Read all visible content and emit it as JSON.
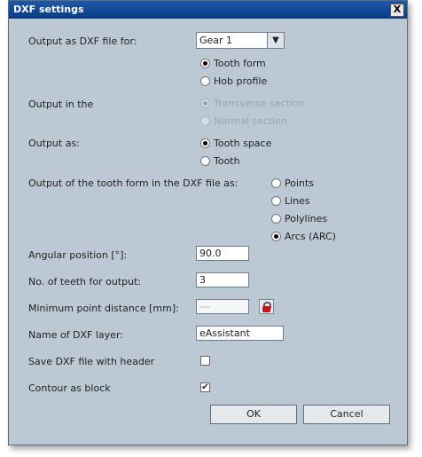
{
  "window": {
    "title": "DXF settings",
    "close_glyph": "X"
  },
  "output_for": {
    "label": "Output as DXF file for:",
    "selected": "Gear 1",
    "options": [
      {
        "label": "Tooth form",
        "checked": true
      },
      {
        "label": "Hob profile",
        "checked": false
      }
    ]
  },
  "output_in": {
    "label": "Output in the",
    "options": [
      {
        "label": "Transverse section",
        "checked": true,
        "disabled": true
      },
      {
        "label": "Normal section",
        "checked": false,
        "disabled": true
      }
    ]
  },
  "output_as": {
    "label": "Output as:",
    "options": [
      {
        "label": "Tooth space",
        "checked": true
      },
      {
        "label": "Tooth",
        "checked": false
      }
    ]
  },
  "tooth_form": {
    "label": "Output of the tooth form in the DXF file as:",
    "options": [
      {
        "label": "Points",
        "checked": false
      },
      {
        "label": "Lines",
        "checked": false
      },
      {
        "label": "Polylines",
        "checked": false
      },
      {
        "label": "Arcs (ARC)",
        "checked": true
      }
    ]
  },
  "fields": {
    "angular_label": "Angular position [°]:",
    "angular_value": "90.0",
    "teeth_label": "No. of teeth for output:",
    "teeth_value": "3",
    "min_dist_label": "Minimum point distance [mm]:",
    "min_dist_value": "---",
    "layer_label": "Name of DXF layer:",
    "layer_value": "eAssistant"
  },
  "checks": {
    "header_label": "Save DXF file with header",
    "header_checked": false,
    "block_label": "Contour as block",
    "block_checked": true,
    "check_glyph": "✔"
  },
  "buttons": {
    "ok": "OK",
    "cancel": "Cancel"
  }
}
